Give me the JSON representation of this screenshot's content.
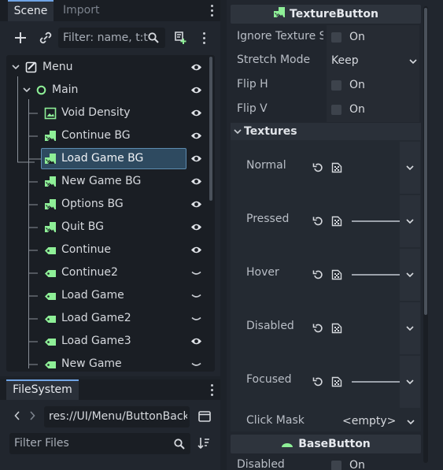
{
  "scene_dock": {
    "tabs": [
      "Scene",
      "Import"
    ],
    "filter_placeholder": "Filter: name, t:t",
    "tree": [
      {
        "label": "Menu",
        "icon": "control-icon"
      },
      {
        "label": "Main",
        "icon": "node2d-circle-icon"
      },
      {
        "label": "Void Density",
        "icon": "texture-rect-icon"
      },
      {
        "label": "Continue BG",
        "icon": "texture-button-icon"
      },
      {
        "label": "Load Game BG",
        "icon": "texture-button-icon",
        "selected": true
      },
      {
        "label": "New Game BG",
        "icon": "texture-button-icon"
      },
      {
        "label": "Options BG",
        "icon": "texture-button-icon"
      },
      {
        "label": "Quit BG",
        "icon": "texture-button-icon"
      },
      {
        "label": "Continue",
        "icon": "label-icon"
      },
      {
        "label": "Continue2",
        "icon": "label-icon"
      },
      {
        "label": "Load Game",
        "icon": "label-icon"
      },
      {
        "label": "Load Game2",
        "icon": "label-icon"
      },
      {
        "label": "Load Game3",
        "icon": "label-icon"
      },
      {
        "label": "New Game",
        "icon": "label-icon"
      }
    ]
  },
  "filesystem": {
    "tab": "FileSystem",
    "path": "res://UI/Menu/ButtonBack",
    "filter_placeholder": "Filter Files"
  },
  "inspector": {
    "header": "TextureButton",
    "props": [
      {
        "name": "Ignore Texture S",
        "value": "On"
      },
      {
        "name": "Stretch Mode",
        "value": "Keep"
      },
      {
        "name": "Flip H",
        "value": "On"
      },
      {
        "name": "Flip V",
        "value": "On"
      }
    ],
    "textures_header": "Textures",
    "textures": [
      "Normal",
      "Pressed",
      "Hover",
      "Disabled",
      "Focused"
    ],
    "click_mask": {
      "name": "Click Mask",
      "value": "<empty>"
    },
    "base_header": "BaseButton",
    "base_props": [
      {
        "name": "Disabled",
        "value": "On"
      }
    ]
  },
  "colors": {
    "accent": "#6fa4e6",
    "icon_green": "#8eef97",
    "selection": "#2e4a60"
  }
}
